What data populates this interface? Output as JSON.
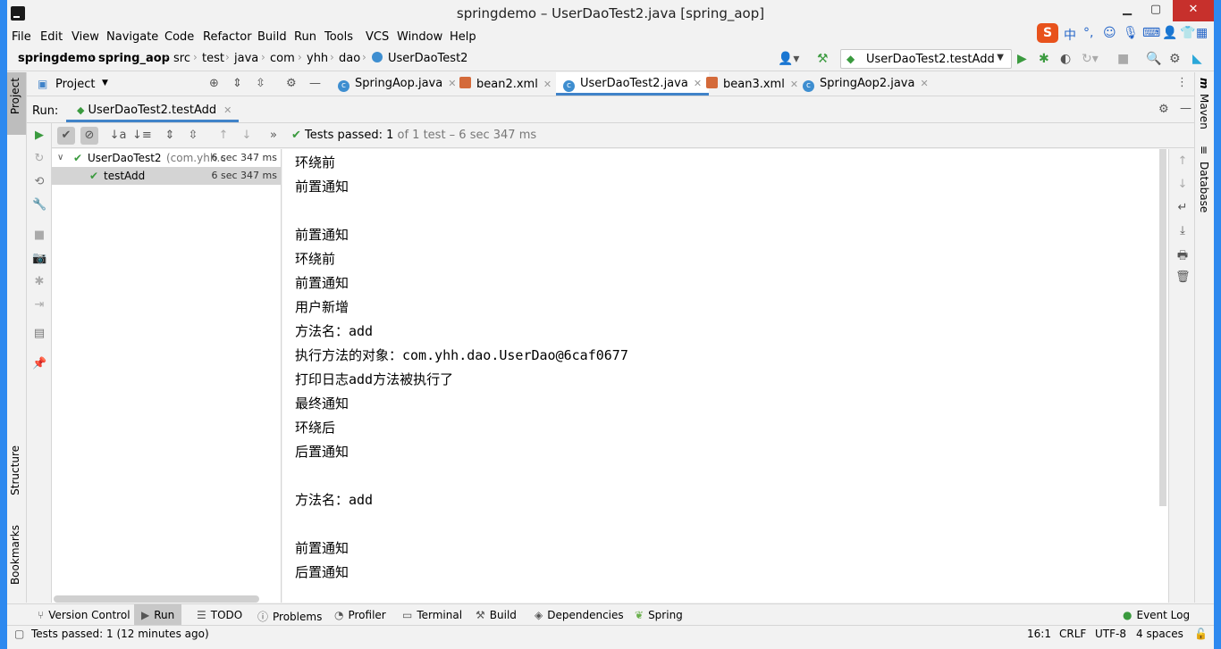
{
  "window": {
    "title": "springdemo – UserDaoTest2.java [spring_aop]"
  },
  "menu": [
    "File",
    "Edit",
    "View",
    "Navigate",
    "Code",
    "Refactor",
    "Build",
    "Run",
    "Tools",
    "VCS",
    "Window",
    "Help"
  ],
  "ime": {
    "logo": "S",
    "mode": "中"
  },
  "breadcrumb": [
    "springdemo",
    "spring_aop",
    "src",
    "test",
    "java",
    "com",
    "yhh",
    "dao",
    "UserDaoTest2"
  ],
  "run_config": {
    "label": "UserDaoTest2.testAdd"
  },
  "project_panel": {
    "label": "Project"
  },
  "editor_tabs": [
    {
      "label": "SpringAop.java",
      "type": "java"
    },
    {
      "label": "bean2.xml",
      "type": "xml"
    },
    {
      "label": "UserDaoTest2.java",
      "type": "java",
      "active": true
    },
    {
      "label": "bean3.xml",
      "type": "xml"
    },
    {
      "label": "SpringAop2.java",
      "type": "java"
    }
  ],
  "run_panel": {
    "run_label": "Run:",
    "tab_label": "UserDaoTest2.testAdd",
    "status": {
      "text": "Tests passed:",
      "passed": "1",
      "suffix": "of 1 test – 6 sec 347 ms"
    }
  },
  "test_tree": [
    {
      "name": "UserDaoTest2",
      "pkg": "(com.yhh.c",
      "time": "6 sec 347 ms"
    },
    {
      "name": "testAdd",
      "time": "6 sec 347 ms"
    }
  ],
  "console_lines": [
    "环绕前",
    "前置通知",
    "",
    "前置通知",
    "环绕前",
    "前置通知",
    "用户新增",
    "方法名：add",
    "执行方法的对象：com.yhh.dao.UserDao@6caf0677",
    "打印日志add方法被执行了",
    "最终通知",
    "环绕后",
    "后置通知",
    "",
    "方法名：add",
    "",
    "前置通知",
    "后置通知"
  ],
  "left_strip_tabs": [
    "Project",
    "Structure",
    "Bookmarks"
  ],
  "right_strip_tabs": [
    "Maven",
    "Database"
  ],
  "bottom_tabs": [
    {
      "label": "Version Control",
      "icon": "branch-icon"
    },
    {
      "label": "Run",
      "icon": "play-icon",
      "active": true
    },
    {
      "label": "TODO",
      "icon": "list-icon"
    },
    {
      "label": "Problems",
      "icon": "warning-icon"
    },
    {
      "label": "Profiler",
      "icon": "profiler-icon"
    },
    {
      "label": "Terminal",
      "icon": "terminal-icon"
    },
    {
      "label": "Build",
      "icon": "hammer-icon"
    },
    {
      "label": "Dependencies",
      "icon": "layers-icon"
    },
    {
      "label": "Spring",
      "icon": "leaf-icon"
    }
  ],
  "event_log": "Event Log",
  "statusbar": {
    "message": "Tests passed: 1 (12 minutes ago)",
    "position": "16:1",
    "line_sep": "CRLF",
    "encoding": "UTF-8",
    "indent": "4 spaces"
  }
}
